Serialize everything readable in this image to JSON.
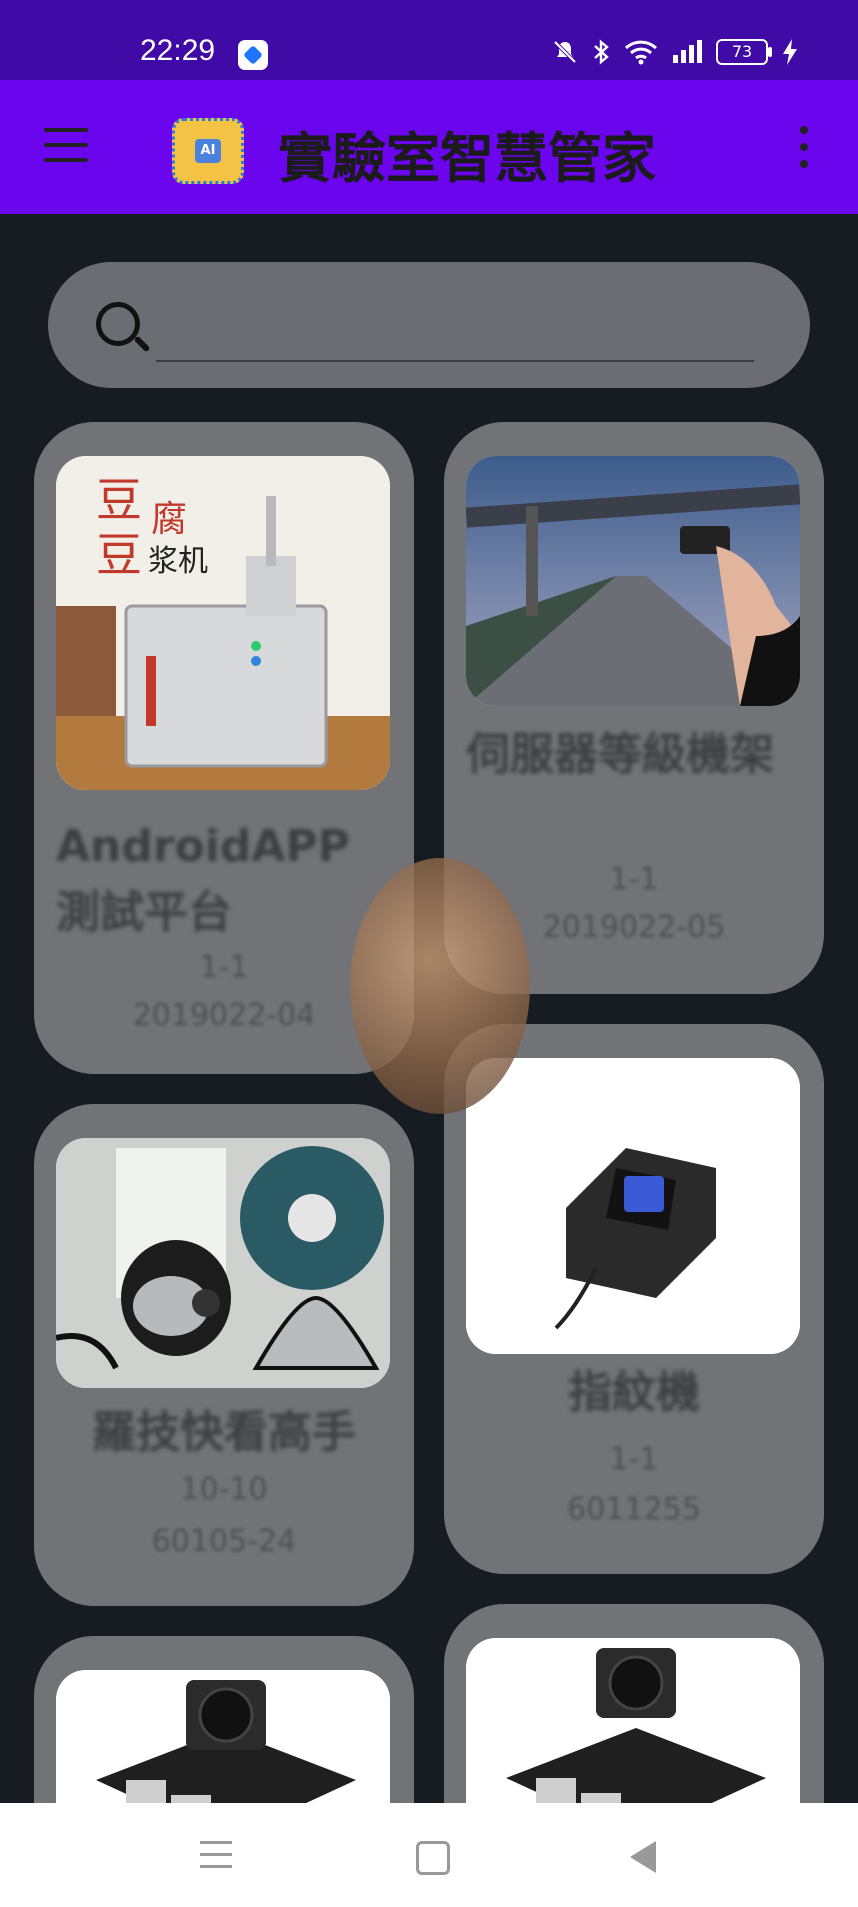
{
  "status_bar": {
    "time": "22:29",
    "battery": "73",
    "icons": [
      "app-icon",
      "mute-icon",
      "bluetooth-icon",
      "wifi-icon",
      "signal-icon",
      "battery-icon",
      "charging-icon"
    ]
  },
  "app_bar": {
    "title": "實驗室智慧管家",
    "logo_text": "AI"
  },
  "search": {
    "placeholder": "",
    "value": ""
  },
  "cards": [
    {
      "name": "AndroidAPP測試平台",
      "count": "1-1",
      "code": "2019022-04"
    },
    {
      "name": "伺服器等級機架",
      "count": "1-1",
      "code": "2019022-05"
    },
    {
      "name": "羅技快看高手",
      "count": "10-10",
      "code": "60105-24"
    },
    {
      "name": "指紋機",
      "count": "1-1",
      "code": "6011255"
    },
    {
      "name": "",
      "count": "",
      "code": ""
    },
    {
      "name": "",
      "count": "",
      "code": ""
    }
  ],
  "colors": {
    "status_bar": "#3f0aa6",
    "app_bar": "#6a05ee",
    "background": "#171c22",
    "card": "#717377"
  }
}
